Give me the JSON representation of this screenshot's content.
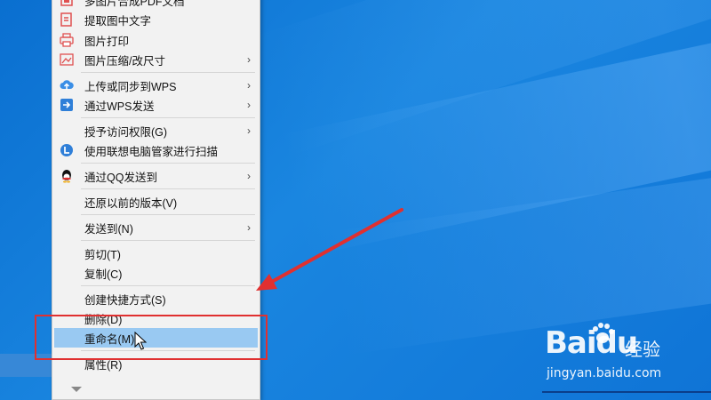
{
  "menu": {
    "items": [
      {
        "label": "多图片合成PDF文档",
        "icon": "pdf-merge-icon",
        "submenu": false
      },
      {
        "label": "提取图中文字",
        "icon": "text-extract-icon",
        "submenu": false
      },
      {
        "label": "图片打印",
        "icon": "printer-icon",
        "submenu": false
      },
      {
        "label": "图片压缩/改尺寸",
        "icon": "image-compress-icon",
        "submenu": true
      },
      {
        "label": "上传或同步到WPS",
        "icon": "cloud-upload-icon",
        "submenu": true
      },
      {
        "label": "通过WPS发送",
        "icon": "wps-send-icon",
        "submenu": true
      },
      {
        "label": "授予访问权限(G)",
        "icon": "",
        "submenu": true
      },
      {
        "label": "使用联想电脑管家进行扫描",
        "icon": "lenovo-scan-icon",
        "submenu": false
      },
      {
        "label": "通过QQ发送到",
        "icon": "qq-icon",
        "submenu": true
      },
      {
        "label": "还原以前的版本(V)",
        "icon": "",
        "submenu": false
      },
      {
        "label": "发送到(N)",
        "icon": "",
        "submenu": true
      },
      {
        "label": "剪切(T)",
        "icon": "",
        "submenu": false
      },
      {
        "label": "复制(C)",
        "icon": "",
        "submenu": false
      },
      {
        "label": "创建快捷方式(S)",
        "icon": "",
        "submenu": false
      },
      {
        "label": "删除(D)",
        "icon": "",
        "submenu": false
      },
      {
        "label": "重命名(M)",
        "icon": "",
        "submenu": false,
        "highlighted": true
      },
      {
        "label": "属性(R)",
        "icon": "",
        "submenu": false
      }
    ],
    "submenu_glyph": "›"
  },
  "watermark": {
    "brand": "Baidu",
    "product": "经验",
    "url": "jingyan.baidu.com"
  },
  "colors": {
    "desktop": "#1a86e0",
    "menu_bg": "#f2f2f2",
    "highlight": "#99c9f2",
    "annotation_red": "#e03030"
  }
}
